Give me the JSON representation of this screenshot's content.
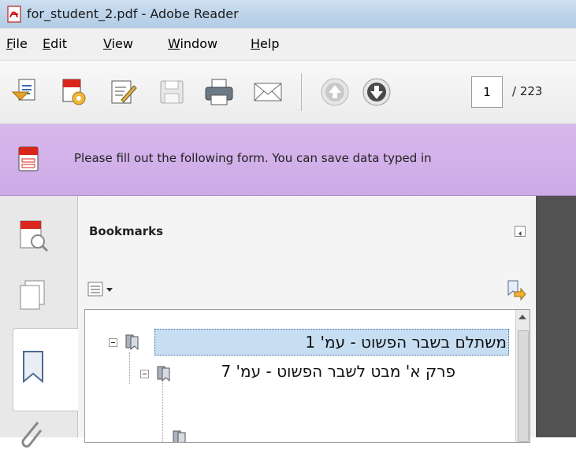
{
  "window": {
    "title": "for_student_2.pdf - Adobe Reader"
  },
  "menu": {
    "items": [
      {
        "key": "F",
        "rest": "ile"
      },
      {
        "key": "E",
        "rest": "dit"
      },
      {
        "key": "V",
        "rest": "iew"
      },
      {
        "key": "W",
        "rest": "indow"
      },
      {
        "key": "H",
        "rest": "elp"
      }
    ]
  },
  "toolbar": {
    "page_value": "1",
    "page_total": "/ 223"
  },
  "form_notice": {
    "text": "Please fill out the following form. You can save data typed in"
  },
  "bookmarks": {
    "title": "Bookmarks",
    "items": [
      {
        "label": "משתלם בשבר הפשוט - עמ' 1",
        "selected": true
      },
      {
        "label": "פרק א' מבט לשבר הפשוט - עמ' 7",
        "selected": false
      }
    ]
  },
  "colors": {
    "form_bar": "#d3b0ea",
    "selection": "#c6ddf2",
    "doc_bg": "#525252"
  },
  "icons": {
    "app": "adobe-reader-icon",
    "toolbar": [
      "create-pdf-icon",
      "settings-pdf-icon",
      "edit-icon",
      "save-icon",
      "print-icon",
      "email-icon",
      "page-up-icon",
      "page-down-icon"
    ],
    "sidebar": [
      "page-thumbnails-icon",
      "layers-icon",
      "bookmark-icon",
      "attachment-icon"
    ]
  }
}
